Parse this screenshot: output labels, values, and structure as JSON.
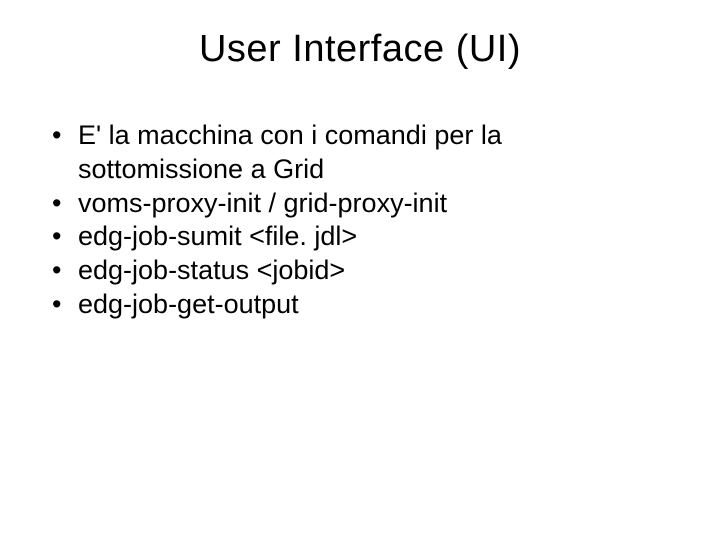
{
  "title": "User Interface (UI)",
  "bullets": [
    "E' la macchina con i comandi per la sottomissione a Grid",
    "voms-proxy-init / grid-proxy-init",
    "edg-job-sumit <file. jdl>",
    "edg-job-status <jobid>",
    "edg-job-get-output"
  ]
}
